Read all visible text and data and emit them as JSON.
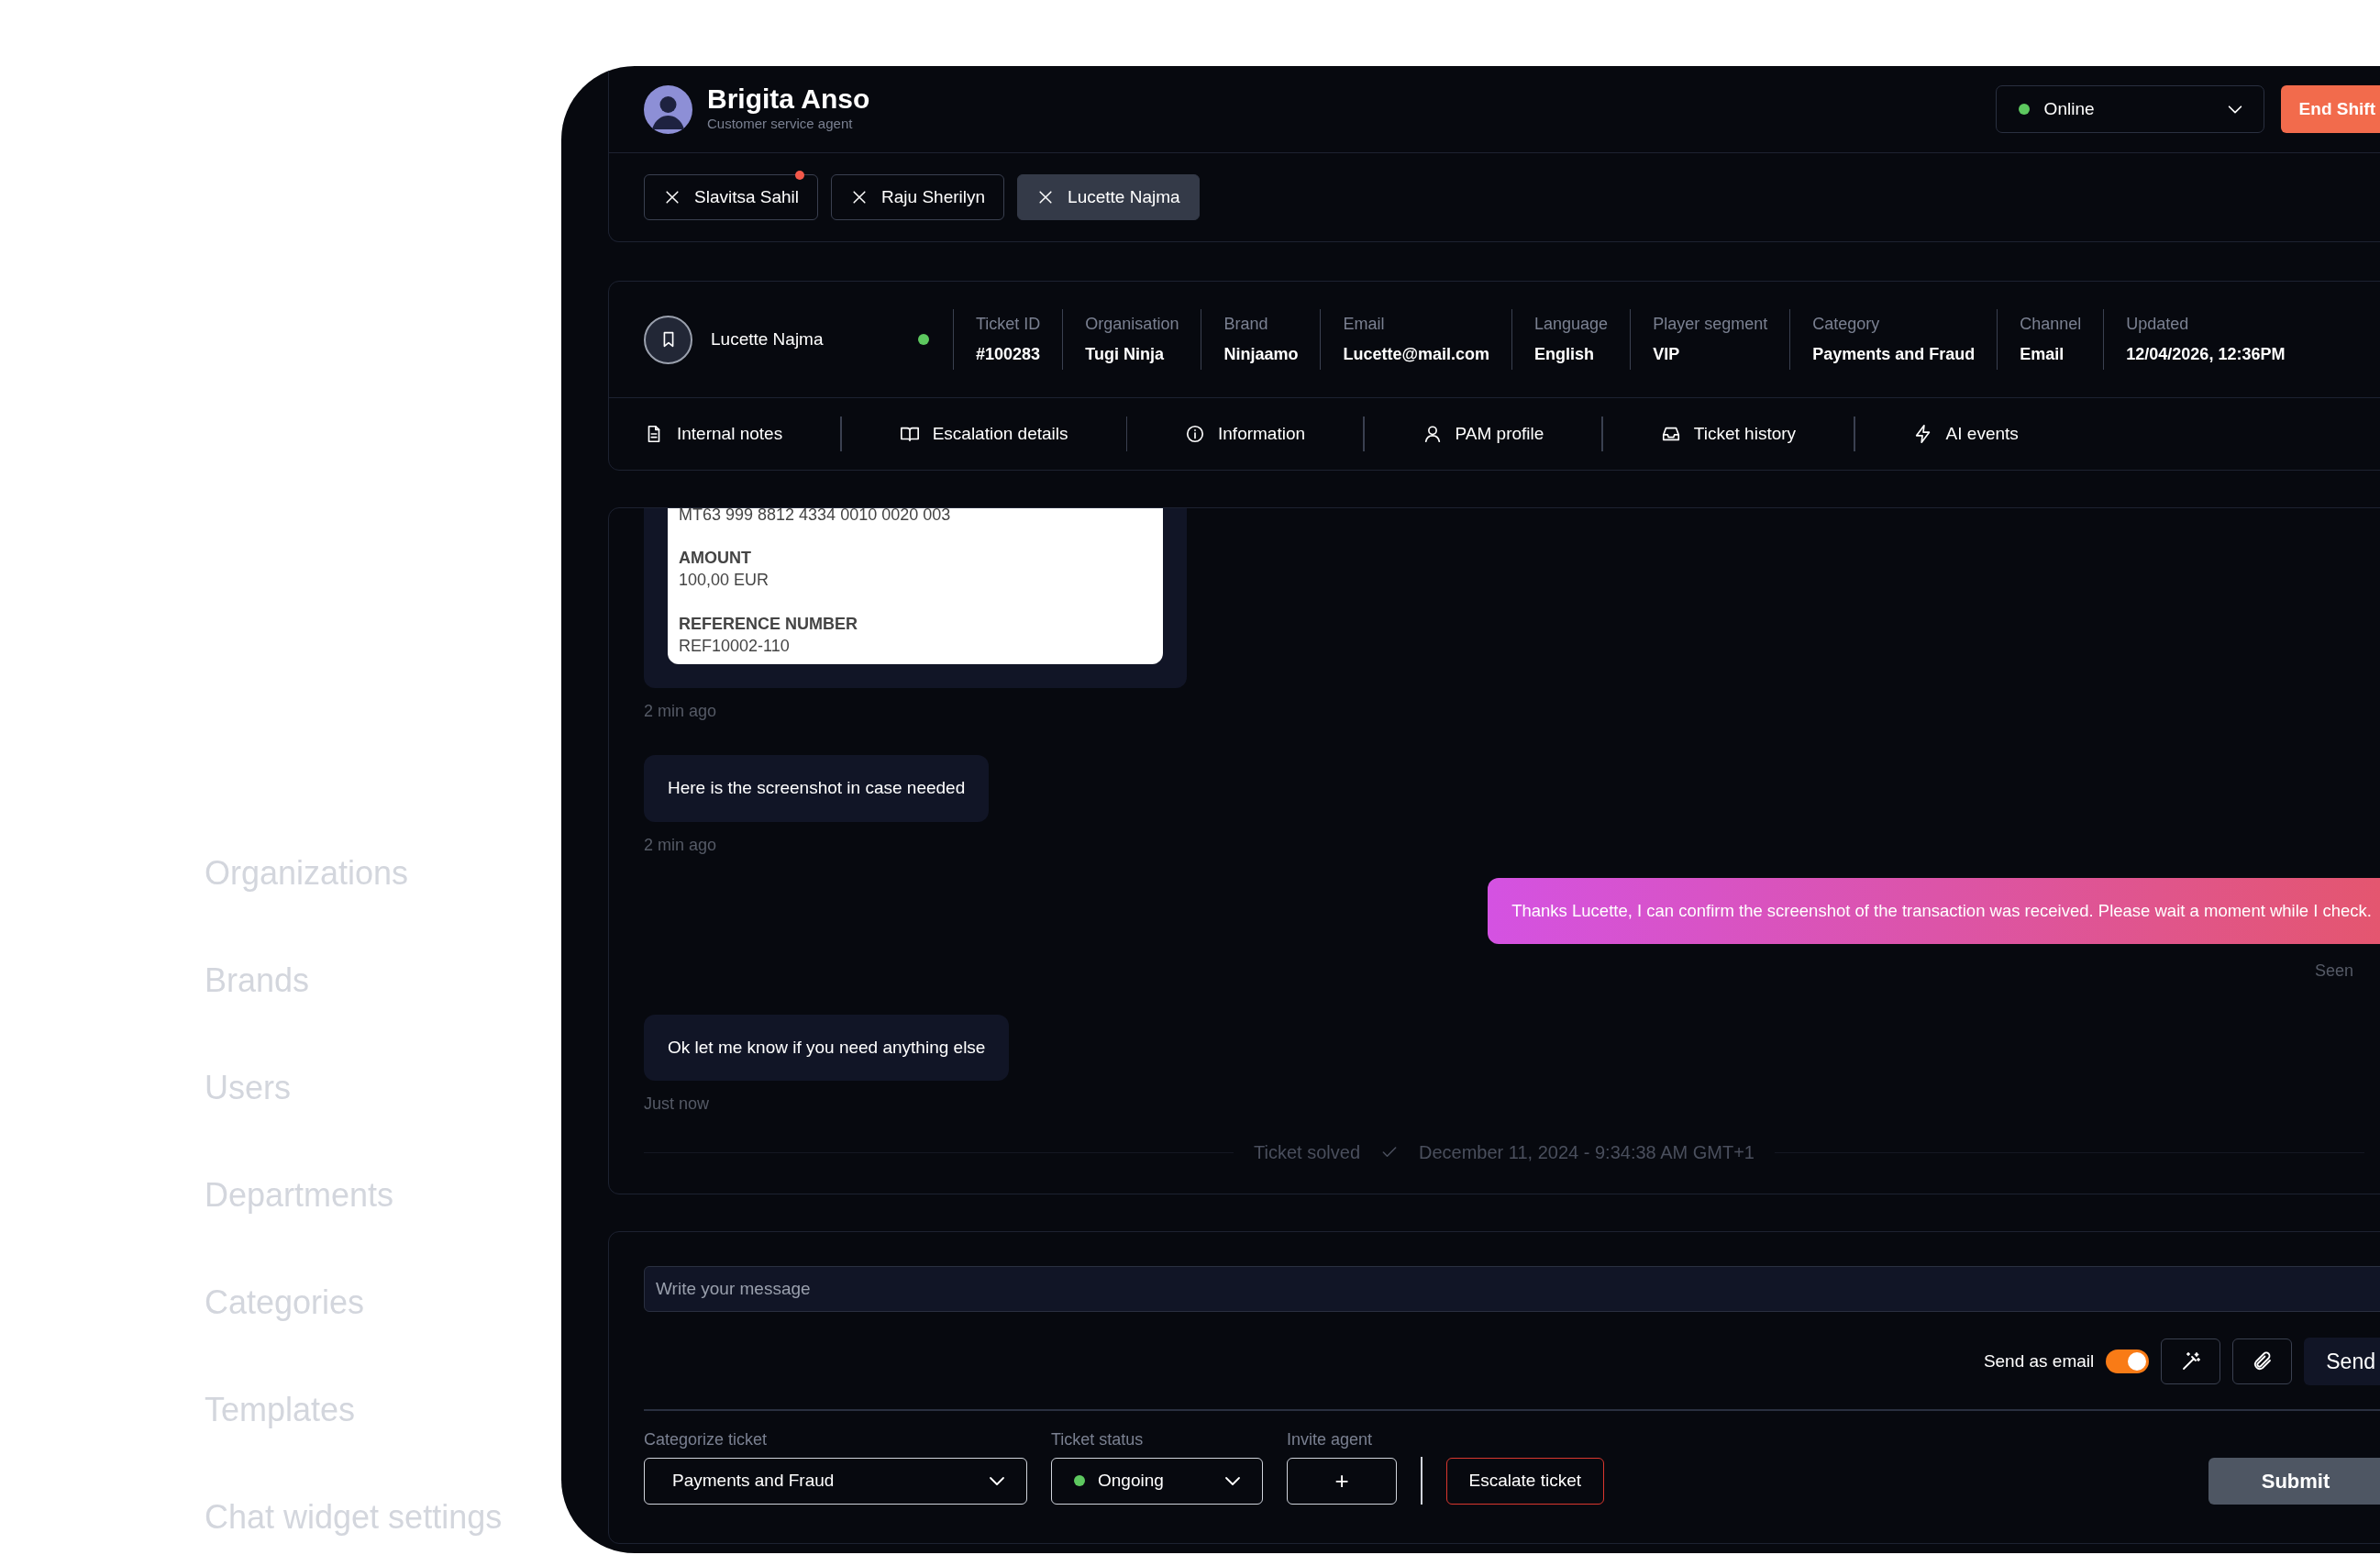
{
  "sidebar": {
    "items": [
      {
        "label": "Organizations"
      },
      {
        "label": "Brands"
      },
      {
        "label": "Users"
      },
      {
        "label": "Departments"
      },
      {
        "label": "Categories"
      },
      {
        "label": "Templates"
      },
      {
        "label": "Chat widget settings"
      }
    ]
  },
  "agent": {
    "name": "Brigita Anso",
    "role": "Customer service agent"
  },
  "status_select": {
    "value": "Online"
  },
  "end_shift_button": "End Shift",
  "chat_tabs": [
    {
      "label": "Slavitsa Sahil",
      "selected": false,
      "unread": true
    },
    {
      "label": "Raju Sherilyn",
      "selected": false,
      "unread": false
    },
    {
      "label": "Lucette Najma",
      "selected": true,
      "unread": false
    }
  ],
  "ticket": {
    "customer": "Lucette Najma",
    "online": true,
    "fields": [
      {
        "label": "Ticket ID",
        "value": "#100283"
      },
      {
        "label": "Organisation",
        "value": "Tugi Ninja"
      },
      {
        "label": "Brand",
        "value": "Ninjaamo"
      },
      {
        "label": "Email",
        "value": "Lucette@mail.com"
      },
      {
        "label": "Language",
        "value": "English"
      },
      {
        "label": "Player segment",
        "value": "VIP"
      },
      {
        "label": "Category",
        "value": "Payments and Fraud"
      },
      {
        "label": "Channel",
        "value": "Email"
      },
      {
        "label": "Updated",
        "value": "12/04/2026, 12:36PM"
      }
    ]
  },
  "sections": [
    {
      "label": "Internal notes"
    },
    {
      "label": "Escalation details"
    },
    {
      "label": "Information"
    },
    {
      "label": "PAM profile"
    },
    {
      "label": "Ticket history"
    },
    {
      "label": "AI events"
    }
  ],
  "messages": [
    {
      "kind": "image",
      "lines": [
        {
          "kind": "value",
          "text": "MT63 999 8812 4334 0010 0020 003"
        },
        {
          "kind": "label",
          "text": "AMOUNT"
        },
        {
          "kind": "value",
          "text": "100,00 EUR"
        },
        {
          "kind": "label",
          "text": "REFERENCE NUMBER"
        },
        {
          "kind": "value",
          "text": "REF10002-110"
        }
      ],
      "time": "2 min ago"
    },
    {
      "kind": "incoming",
      "text": "Here is the screenshot in case needed",
      "time": "2 min ago"
    },
    {
      "kind": "outgoing",
      "text": "Thanks Lucette, I can confirm the screenshot of the transaction was received. Please wait a moment while I check.",
      "status": "Seen"
    },
    {
      "kind": "incoming",
      "text": "Ok let me know if you need anything else",
      "time": "Just now"
    },
    {
      "kind": "event",
      "text": "Ticket solved",
      "date": "December 11, 2024 - 9:34:38 AM GMT+1"
    }
  ],
  "composer": {
    "placeholder": "Write your message",
    "send_as_email": {
      "label": "Send as email",
      "on": true
    },
    "send_button": "Send"
  },
  "footer": {
    "category": {
      "label": "Categorize ticket",
      "value": "Payments and Fraud"
    },
    "status": {
      "label": "Ticket status",
      "value": "Ongoing"
    },
    "invite": {
      "label": "Invite agent",
      "button": "+"
    },
    "escalate_button": "Escalate ticket",
    "submit_button": "Submit"
  }
}
